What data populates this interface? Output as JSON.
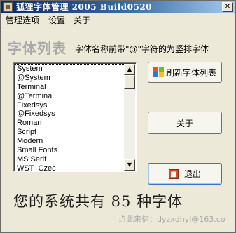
{
  "window": {
    "title": "狐狸字体管理 2005 Build0520",
    "close_glyph": "✕"
  },
  "menu": {
    "items": [
      "管理选项",
      "设置",
      "关于"
    ]
  },
  "header": {
    "heading": "字体列表",
    "hint": "字体名称前带\"@\"字符的为竖排字体"
  },
  "fonts": {
    "items": [
      "System",
      "@System",
      "Terminal",
      "@Terminal",
      "Fixedsys",
      "@Fixedsys",
      "Roman",
      "Script",
      "Modern",
      "Small Fonts",
      "MS Serif",
      "WST_Czec"
    ],
    "selected": "System"
  },
  "buttons": {
    "refresh": "刷新字体列表",
    "about": "关于",
    "exit": "退出"
  },
  "footer": {
    "summary": "您的系统共有 85 种字体",
    "contact": "点此来信：dyzxdhyl@163.co"
  },
  "icons": {
    "app": "fox-app-icon",
    "refresh": "windows-flag-icon",
    "exit": "exit-icon"
  }
}
